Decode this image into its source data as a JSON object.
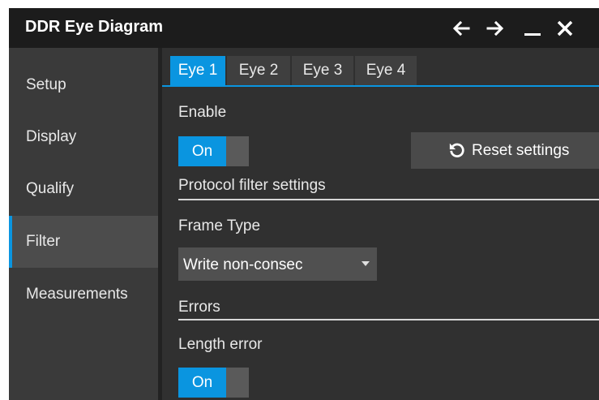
{
  "window": {
    "title": "DDR Eye Diagram"
  },
  "sidebar": {
    "items": [
      {
        "label": "Setup"
      },
      {
        "label": "Display"
      },
      {
        "label": "Qualify"
      },
      {
        "label": "Filter"
      },
      {
        "label": "Measurements"
      }
    ],
    "active": "Filter"
  },
  "tabs": [
    {
      "label": "Eye 1"
    },
    {
      "label": "Eye 2"
    },
    {
      "label": "Eye 3"
    },
    {
      "label": "Eye 4"
    }
  ],
  "active_tab": "Eye 1",
  "content": {
    "enable_label": "Enable",
    "enable_toggle": "On",
    "reset_label": "Reset settings",
    "protocol_section": "Protocol filter settings",
    "frame_type_label": "Frame Type",
    "frame_type_value": "Write non-consec",
    "errors_section": "Errors",
    "length_error_label": "Length error",
    "length_error_toggle": "On"
  },
  "colors": {
    "accent": "#0a95e0",
    "titlebar": "#1c1c1c",
    "sidebar": "#3a3a3a",
    "panel": "#303030"
  },
  "icons": [
    "arrow-left-icon",
    "arrow-right-icon",
    "minimize-icon",
    "close-icon",
    "reset-icon",
    "chevron-down-icon"
  ]
}
